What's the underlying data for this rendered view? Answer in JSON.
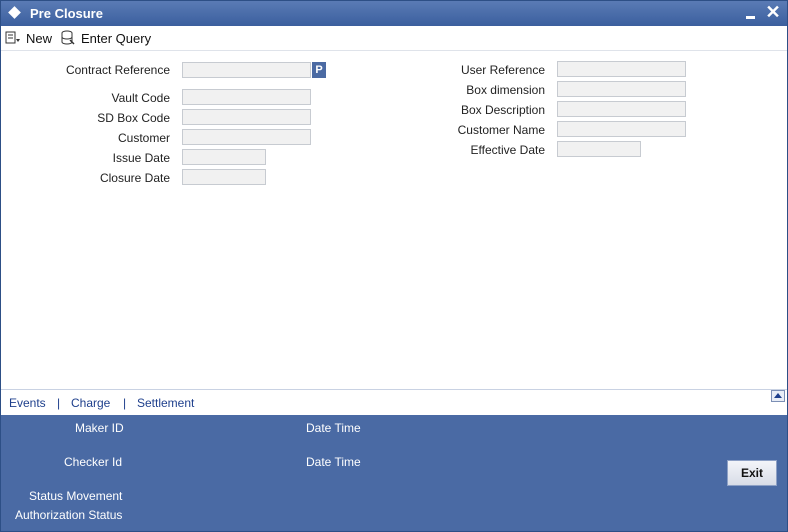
{
  "window": {
    "title": "Pre Closure"
  },
  "toolbar": {
    "new_label": "New",
    "enter_query_label": "Enter Query"
  },
  "form": {
    "contract_reference": {
      "label": "Contract Reference",
      "value": ""
    },
    "p_button": "P",
    "vault_code": {
      "label": "Vault Code",
      "value": ""
    },
    "sd_box_code": {
      "label": "SD Box Code",
      "value": ""
    },
    "customer": {
      "label": "Customer",
      "value": ""
    },
    "issue_date": {
      "label": "Issue Date",
      "value": ""
    },
    "closure_date": {
      "label": "Closure Date",
      "value": ""
    },
    "user_reference": {
      "label": "User Reference",
      "value": ""
    },
    "box_dimension": {
      "label": "Box dimension",
      "value": ""
    },
    "box_description": {
      "label": "Box Description",
      "value": ""
    },
    "customer_name": {
      "label": "Customer Name",
      "value": ""
    },
    "effective_date": {
      "label": "Effective Date",
      "value": ""
    }
  },
  "links": {
    "events": "Events",
    "charge": "Charge",
    "settlement": "Settlement",
    "separator": "|"
  },
  "footer": {
    "maker_id": "Maker ID",
    "checker_id": "Checker Id",
    "date_time_1": "Date Time",
    "date_time_2": "Date Time",
    "status_movement": "Status Movement",
    "authorization_status": "Authorization Status",
    "exit_label": "Exit"
  }
}
